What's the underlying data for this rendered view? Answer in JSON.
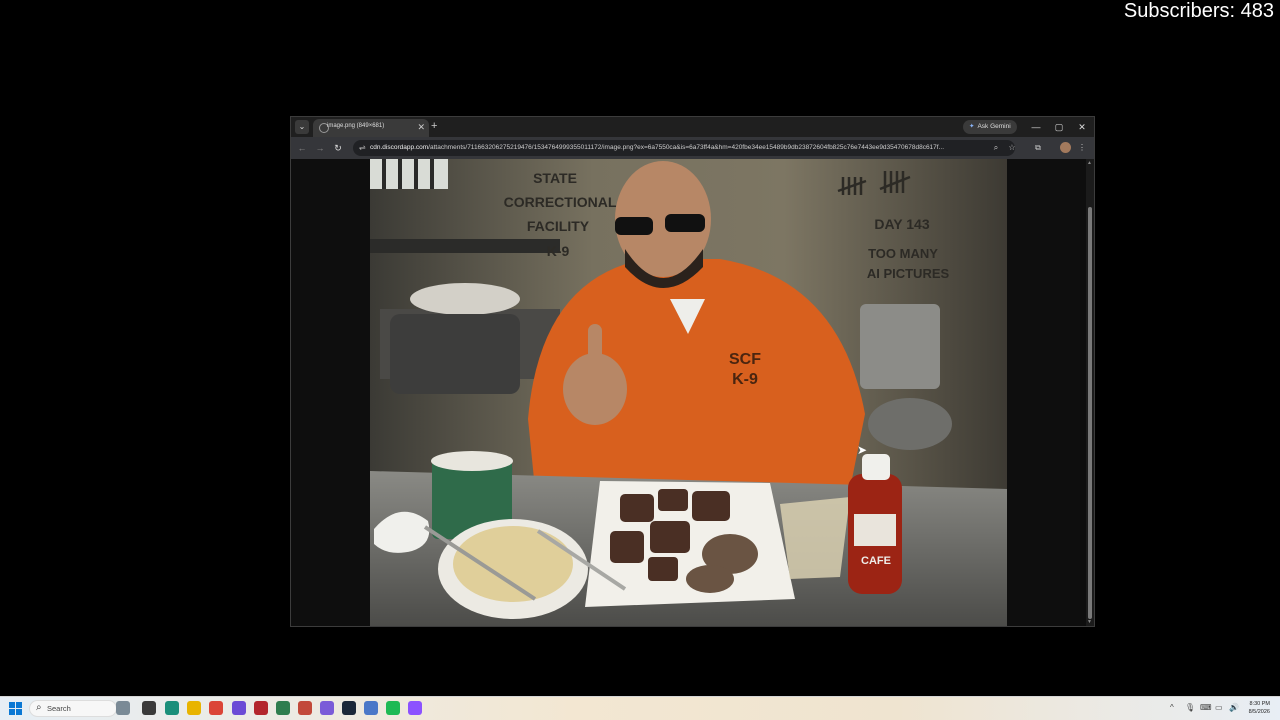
{
  "overlay": {
    "subscribers": "Subscribers: 483"
  },
  "browser": {
    "tab_title": "image.png (849×681)",
    "new_tab": "+",
    "ask_gemini": "Ask Gemini",
    "url_host": "cdn.discordapp.com",
    "url_path": "/attachments/711663206275219476/1534764999355011172/image.png?ex=6a7550ca&is=6a73ff4a&hm=420fbe34ee15489b9db23872604fb825c76e7443ee9d35470678d8c617f...",
    "window_controls": {
      "minimize": "—",
      "maximize": "▢",
      "close": "✕"
    }
  },
  "image": {
    "wall_text_left": [
      "STATE",
      "CORRECTIONAL",
      "FACILITY",
      "K-9"
    ],
    "tally_marks": "𝍸𝍸 𝍸𝍸",
    "wall_text_right": [
      "DAY 143",
      "TOO MANY",
      "AI PICTURES"
    ],
    "shirt_text": [
      "SCF",
      "K-9"
    ],
    "bottle_label": "CAFE"
  },
  "taskbar": {
    "search_placeholder": "Search",
    "apps": [
      {
        "name": "weather",
        "color": "#7a8a96"
      },
      {
        "name": "task-view",
        "color": "#3a3a3a"
      },
      {
        "name": "edge",
        "color": "#1b8f7a"
      },
      {
        "name": "file-explorer",
        "color": "#e8b400"
      },
      {
        "name": "chrome",
        "color": "#db4437"
      },
      {
        "name": "app-purple",
        "color": "#6b4bd6"
      },
      {
        "name": "app-red",
        "color": "#b3262d"
      },
      {
        "name": "app-green",
        "color": "#2e7d4f"
      },
      {
        "name": "app-photo",
        "color": "#c2493a"
      },
      {
        "name": "app-grid",
        "color": "#7a5bd8"
      },
      {
        "name": "steam",
        "color": "#1b2838"
      },
      {
        "name": "app-blue",
        "color": "#4a78c8"
      },
      {
        "name": "spotify",
        "color": "#1db954"
      },
      {
        "name": "app-violet",
        "color": "#8c52ff"
      }
    ],
    "time": "8:30 PM",
    "date": "8/5/2026"
  }
}
